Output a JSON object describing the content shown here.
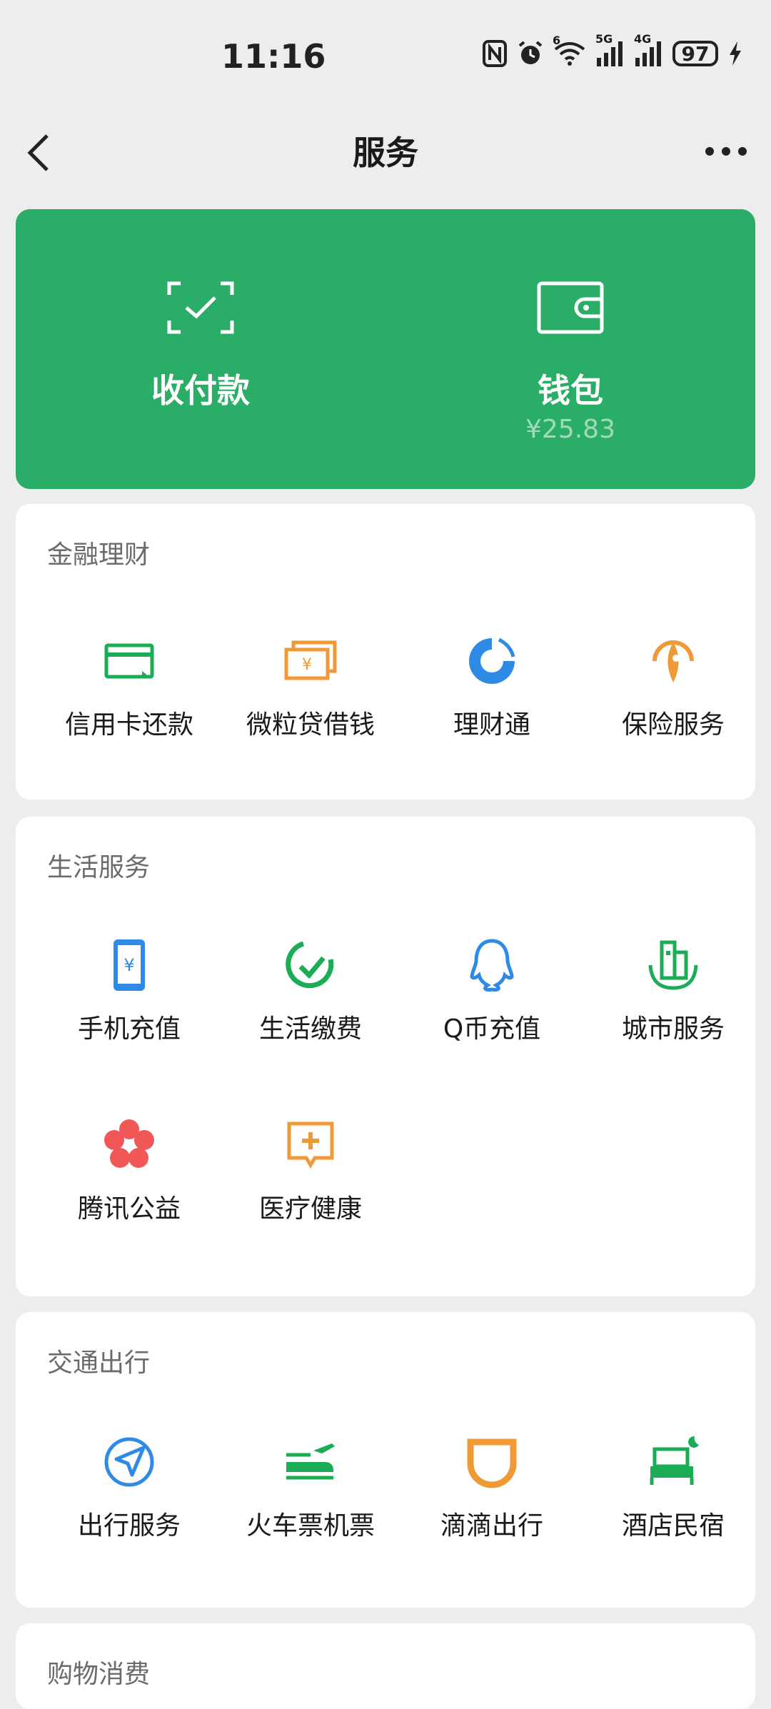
{
  "status_bar": {
    "time": "11:16",
    "battery": "97",
    "network_a": "5G",
    "network_b": "4G",
    "wifi_badge": "6",
    "icons": [
      "nfc-icon",
      "alarm-icon",
      "wifi-icon",
      "signal-icon",
      "signal-icon",
      "battery-icon",
      "charging-icon"
    ]
  },
  "nav": {
    "title": "服务",
    "back_icon": "chevron-left-icon",
    "more_icon": "more-icon"
  },
  "hero": {
    "pay": {
      "label": "收付款",
      "icon": "scan-check-icon"
    },
    "wallet": {
      "label": "钱包",
      "balance": "¥25.83",
      "icon": "wallet-icon"
    },
    "color": "#2aae67"
  },
  "sections": [
    {
      "title": "金融理财",
      "items": [
        {
          "label": "信用卡还款",
          "icon": "credit-card-icon",
          "color": "#1aad56"
        },
        {
          "label": "微粒贷借钱",
          "icon": "loan-icon",
          "color": "#f09a37"
        },
        {
          "label": "理财通",
          "icon": "wealth-icon",
          "color": "#2f8ae5"
        },
        {
          "label": "保险服务",
          "icon": "insurance-icon",
          "color": "#f09a37"
        }
      ]
    },
    {
      "title": "生活服务",
      "items": [
        {
          "label": "手机充值",
          "icon": "phone-topup-icon",
          "color": "#2f8ae5"
        },
        {
          "label": "生活缴费",
          "icon": "utility-bill-icon",
          "color": "#1aad56"
        },
        {
          "label": "Q币充值",
          "icon": "qq-icon",
          "color": "#2f8ae5"
        },
        {
          "label": "城市服务",
          "icon": "city-icon",
          "color": "#1aad56"
        },
        {
          "label": "腾讯公益",
          "icon": "charity-flower-icon",
          "color": "#f25757"
        },
        {
          "label": "医疗健康",
          "icon": "medical-icon",
          "color": "#f09a37"
        }
      ]
    },
    {
      "title": "交通出行",
      "items": [
        {
          "label": "出行服务",
          "icon": "navigation-icon",
          "color": "#2f8ae5"
        },
        {
          "label": "火车票机票",
          "icon": "train-plane-icon",
          "color": "#1aad56"
        },
        {
          "label": "滴滴出行",
          "icon": "didi-icon",
          "color": "#f09a37"
        },
        {
          "label": "酒店民宿",
          "icon": "hotel-bed-icon",
          "color": "#1aad56"
        }
      ]
    },
    {
      "title": "购物消费",
      "items": []
    }
  ]
}
